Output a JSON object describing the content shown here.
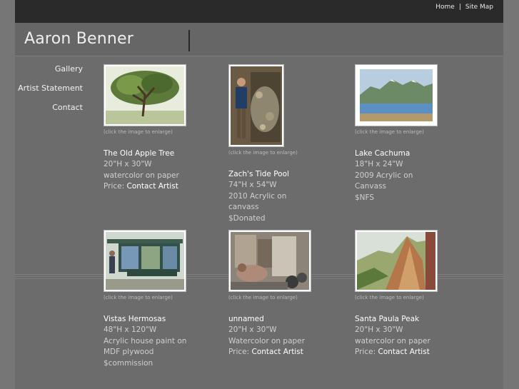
{
  "topnav": {
    "home": "Home",
    "separator": "|",
    "sitemap": "Site Map"
  },
  "site": {
    "title": "Aaron Benner"
  },
  "sidebar": {
    "items": [
      {
        "label": "Gallery"
      },
      {
        "label": "Artist Statement"
      },
      {
        "label": "Contact"
      }
    ]
  },
  "gallery": {
    "hint": "(click the image to enlarge)",
    "items": [
      {
        "title": "The Old Apple Tree",
        "lines": [
          "20\"H x 30\"W",
          "watercolor on paper"
        ],
        "price_label": "Price: ",
        "price_link": "Contact Artist"
      },
      {
        "title": "Zach's Tide Pool",
        "lines": [
          "74\"H x 54\"W",
          "2010 Acrylic on",
          "canvass",
          "$Donated"
        ]
      },
      {
        "title": "Lake Cachuma",
        "lines": [
          "18\"H x 24\"W",
          "2009 Acrylic on",
          "Canvass",
          "$NFS"
        ]
      },
      {
        "title": "Vistas Hermosas",
        "lines": [
          "48\"H x 120\"W",
          "Acrylic house paint on",
          "MDF plywood",
          "$commission"
        ]
      },
      {
        "title": "unnamed",
        "lines": [
          "20\"H x 30\"W",
          "Watercolor on paper"
        ],
        "price_label": "Price: ",
        "price_link": "Contact Artist"
      },
      {
        "title": "Santa Paula Peak",
        "lines": [
          "20\"H x 30\"W",
          "watercolor on paper"
        ],
        "price_label": "Price: ",
        "price_link": "Contact Artist"
      }
    ]
  }
}
